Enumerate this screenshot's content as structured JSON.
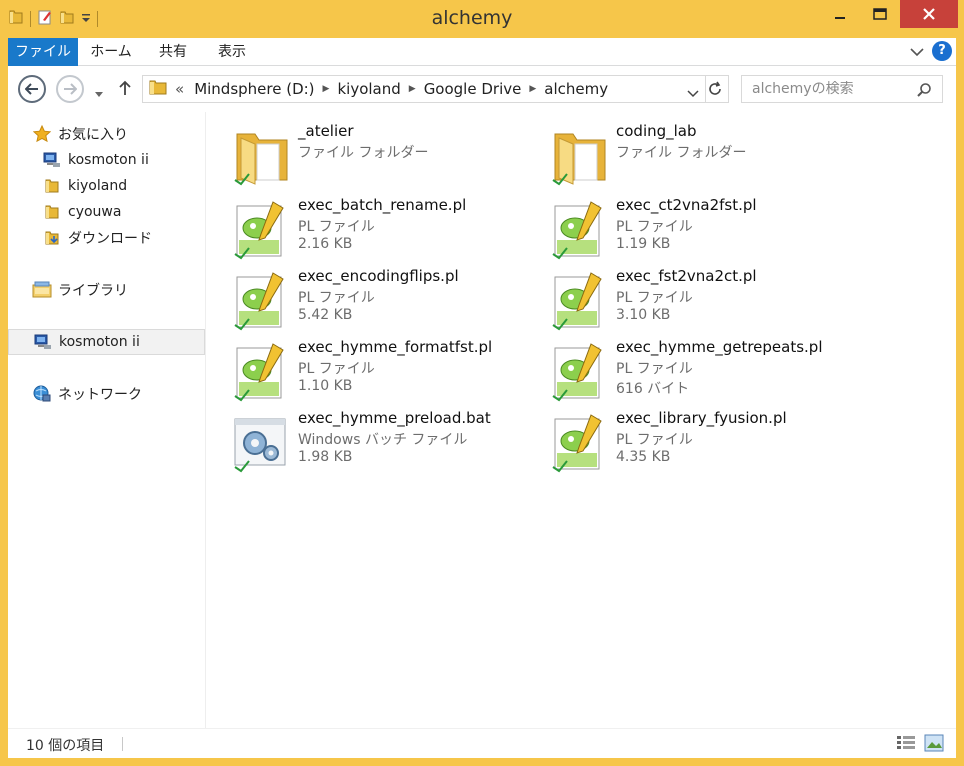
{
  "window": {
    "title": "alchemy"
  },
  "ribbon": {
    "tabs": [
      {
        "label": "ファイル"
      },
      {
        "label": "ホーム"
      },
      {
        "label": "共有"
      },
      {
        "label": "表示"
      }
    ],
    "help_label": "?"
  },
  "address": {
    "overflow": "«",
    "crumbs": [
      "Mindsphere (D:)",
      "kiyoland",
      "Google Drive",
      "alchemy"
    ]
  },
  "search": {
    "placeholder": "alchemyの検索"
  },
  "nav": {
    "favorites_label": "お気に入り",
    "favorites": [
      "kosmoton ii",
      "kiyoland",
      "cyouwa",
      "ダウンロード"
    ],
    "libraries_label": "ライブラリ",
    "computer_label": "kosmoton ii",
    "network_label": "ネットワーク"
  },
  "files": [
    {
      "name": "_atelier",
      "type": "ファイル フォルダー",
      "size": "",
      "icon": "folder-icon"
    },
    {
      "name": "coding_lab",
      "type": "ファイル フォルダー",
      "size": "",
      "icon": "folder-icon"
    },
    {
      "name": "exec_batch_rename.pl",
      "type": "PL ファイル",
      "size": "2.16 KB",
      "icon": "notepadpp-file-icon"
    },
    {
      "name": "exec_ct2vna2fst.pl",
      "type": "PL ファイル",
      "size": "1.19 KB",
      "icon": "notepadpp-file-icon"
    },
    {
      "name": "exec_encodingflips.pl",
      "type": "PL ファイル",
      "size": "5.42 KB",
      "icon": "notepadpp-file-icon"
    },
    {
      "name": "exec_fst2vna2ct.pl",
      "type": "PL ファイル",
      "size": "3.10 KB",
      "icon": "notepadpp-file-icon"
    },
    {
      "name": "exec_hymme_formatfst.pl",
      "type": "PL ファイル",
      "size": "1.10 KB",
      "icon": "notepadpp-file-icon"
    },
    {
      "name": "exec_hymme_getrepeats.pl",
      "type": "PL ファイル",
      "size": "616 バイト",
      "icon": "notepadpp-file-icon"
    },
    {
      "name": "exec_hymme_preload.bat",
      "type": "Windows バッチ ファイル",
      "size": "1.98 KB",
      "icon": "batch-file-icon"
    },
    {
      "name": "exec_library_fyusion.pl",
      "type": "PL ファイル",
      "size": "4.35 KB",
      "icon": "notepadpp-file-icon"
    }
  ],
  "status": {
    "item_count": "10 個の項目"
  },
  "colors": {
    "frame": "#f6c64a",
    "file_tab": "#1979ca",
    "close": "#c7413a",
    "selection": "#f2f2f2"
  }
}
